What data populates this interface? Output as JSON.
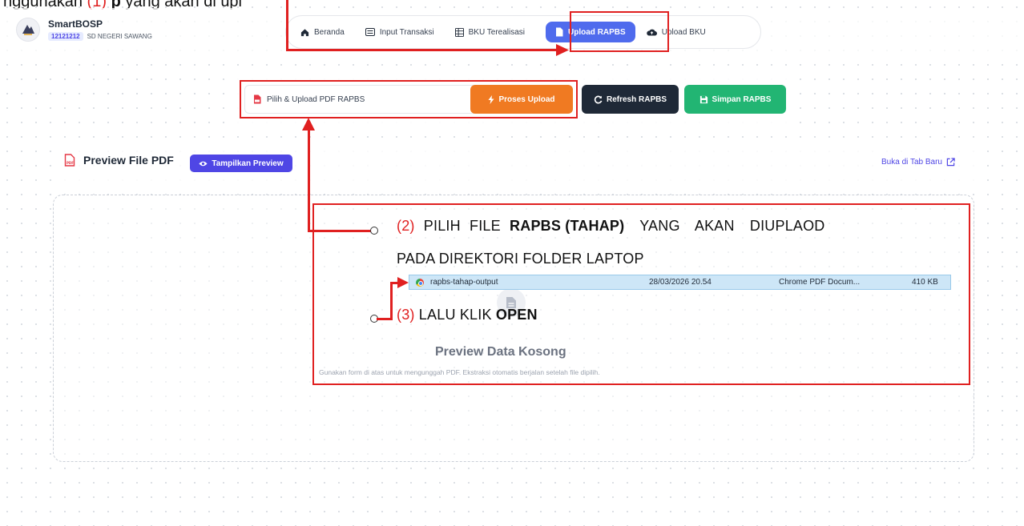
{
  "caption_top": {
    "prefix": "nggunakan ",
    "number": "(1)",
    "middle": " ",
    "bold": "p",
    "suffix": " yang akan di upl"
  },
  "brand": {
    "name": "SmartBOSP",
    "npsn": "12121212",
    "school": "SD NEGERI SAWANG"
  },
  "nav": {
    "items": [
      {
        "label": "Beranda",
        "icon": "home-icon"
      },
      {
        "label": "Input Transaksi",
        "icon": "keyboard-icon"
      },
      {
        "label": "BKU Terealisasi",
        "icon": "table-icon"
      },
      {
        "label": "Upload RAPBS",
        "icon": "file-icon",
        "active": true
      },
      {
        "label": "Upload BKU",
        "icon": "cloud-upload-icon"
      }
    ]
  },
  "toolbar": {
    "file_label": "Pilih & Upload PDF RAPBS",
    "proses_label": "Proses Upload",
    "refresh_label": "Refresh RAPBS",
    "simpan_label": "Simpan RAPBS"
  },
  "preview": {
    "title": "Preview File PDF",
    "show_label": "Tampilkan Preview",
    "open_new_tab": "Buka di Tab Baru",
    "empty_title": "Preview Data Kosong",
    "empty_desc": "Gunakan form di atas untuk mengunggah PDF. Ekstraksi otomatis berjalan setelah file dipilih."
  },
  "annotations": {
    "step2": {
      "number": "(2)",
      "text_a": " PILIH FILE ",
      "bold": "RAPBS (TAHAP)",
      "text_b": " YANG AKAN DIUPLAOD",
      "line2": "PADA DIREKTORI FOLDER LAPTOP"
    },
    "step3": {
      "number": "(3)",
      "text": " LALU KLIK ",
      "bold": "OPEN"
    }
  },
  "file_row": {
    "name": "rapbs-tahap-output",
    "date": "28/03/2026 20.54",
    "type": "Chrome PDF Docum...",
    "size": "410 KB"
  },
  "colors": {
    "annotation": "#e02020",
    "active_nav": "#4f6bed",
    "proses": "#f07a22",
    "refresh": "#1f2937",
    "simpan": "#22b573",
    "tampilkan": "#4f46e5"
  }
}
